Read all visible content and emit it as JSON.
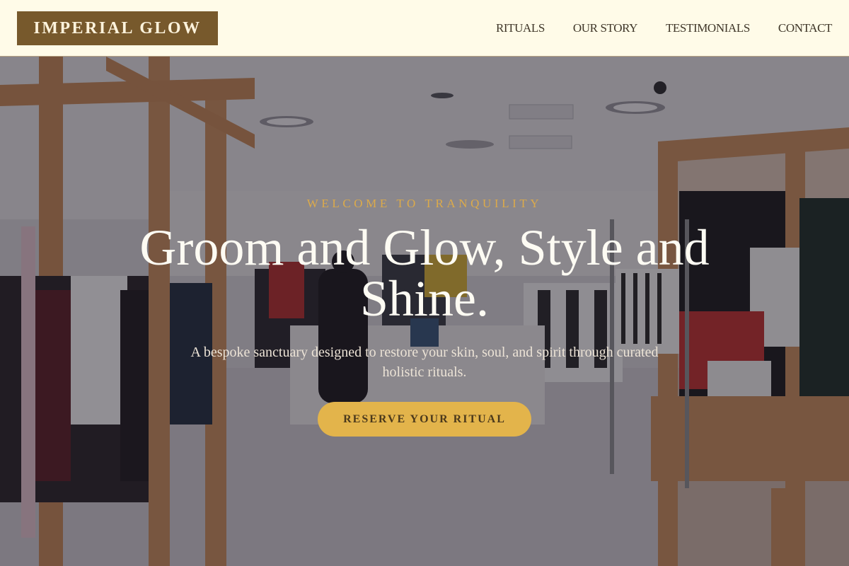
{
  "brand": {
    "logo_text": "IMPERIAL GLOW"
  },
  "nav": {
    "items": [
      {
        "label": "RITUALS"
      },
      {
        "label": "OUR STORY"
      },
      {
        "label": "TESTIMONIALS"
      },
      {
        "label": "CONTACT"
      }
    ]
  },
  "hero": {
    "eyebrow": "WELCOME TO TRANQUILITY",
    "headline": "Groom and Glow, Style and Shine.",
    "subtitle": "A bespoke sanctuary designed to restore your skin, soul, and spirit through curated holistic rituals.",
    "cta_label": "RESERVE YOUR RITUAL",
    "background_image": "clothing boutique interior"
  },
  "colors": {
    "header_bg": "#fffbe8",
    "logo_bg": "#77592c",
    "logo_text": "#fdf3dc",
    "nav_text": "#3f3628",
    "accent_gold": "#e3b44b",
    "eyebrow_text": "#dcaa4a",
    "headline_text": "#fdfbf3"
  }
}
